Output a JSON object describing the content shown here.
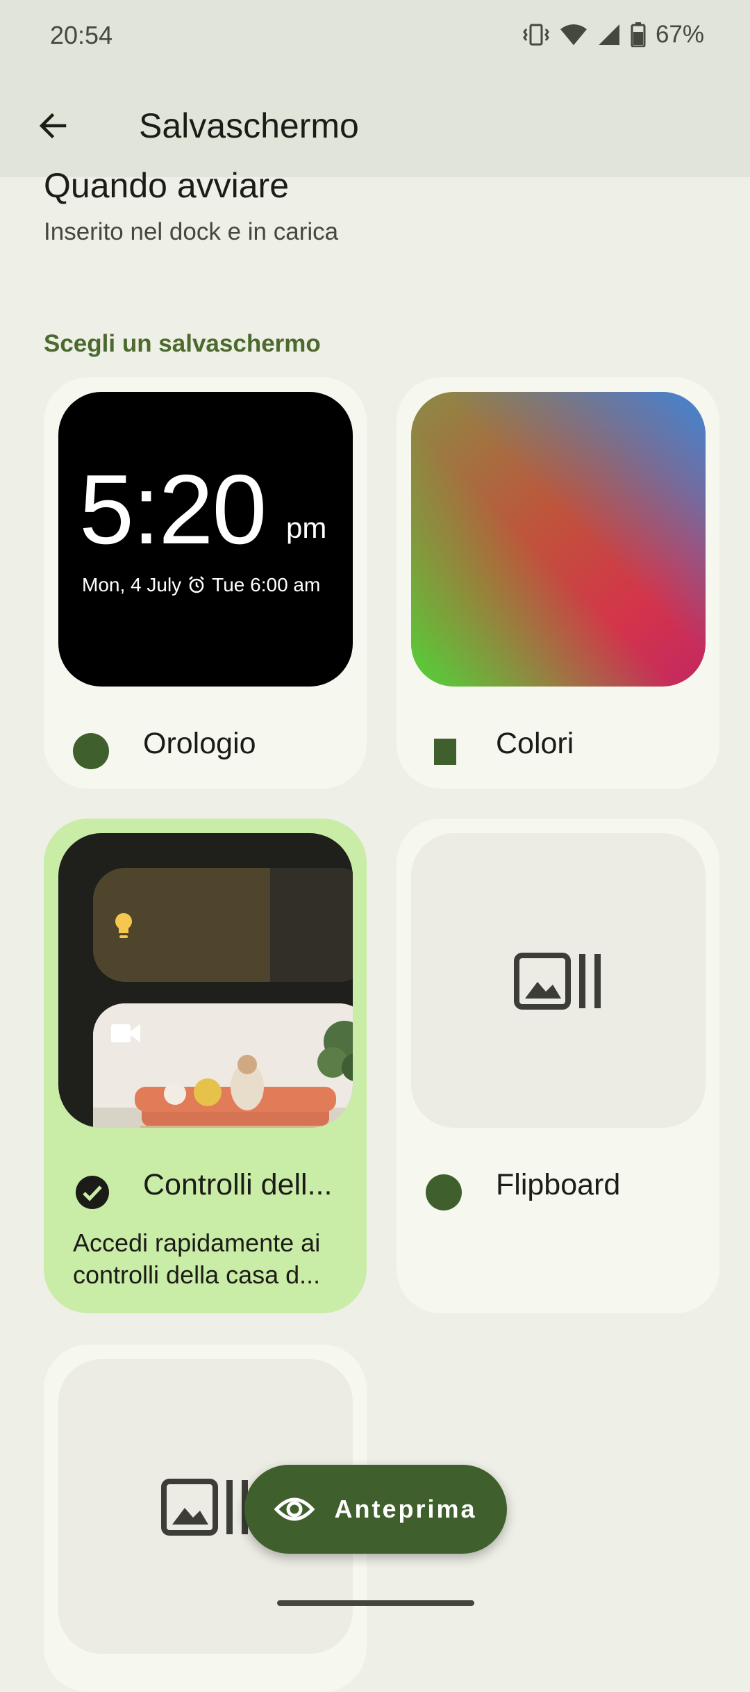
{
  "status": {
    "time": "20:54",
    "battery": "67%"
  },
  "header": {
    "title": "Salvaschermo"
  },
  "when": {
    "title": "Quando avviare",
    "value": "Inserito nel dock e in carica"
  },
  "picker": {
    "label": "Scegli un salvaschermo"
  },
  "cards": [
    {
      "label": "Orologio",
      "clock_time": "5:20",
      "clock_ampm": "pm",
      "clock_date": "Mon, 4 July",
      "clock_alarm": "Tue 6:00 am"
    },
    {
      "label": "Colori"
    },
    {
      "label": "Controlli dell...",
      "description": "Accedi rapidamente ai controlli della casa d...",
      "selected": true
    },
    {
      "label": "Flipboard"
    },
    {
      "label": ""
    }
  ],
  "fab": {
    "label": "Anteprima",
    "icon": "eye-icon"
  },
  "colors": {
    "accent": "#3F5F2C",
    "selected_card": "#C9ECA7",
    "background": "#EEEFE6",
    "header": "#E1E4D8"
  }
}
